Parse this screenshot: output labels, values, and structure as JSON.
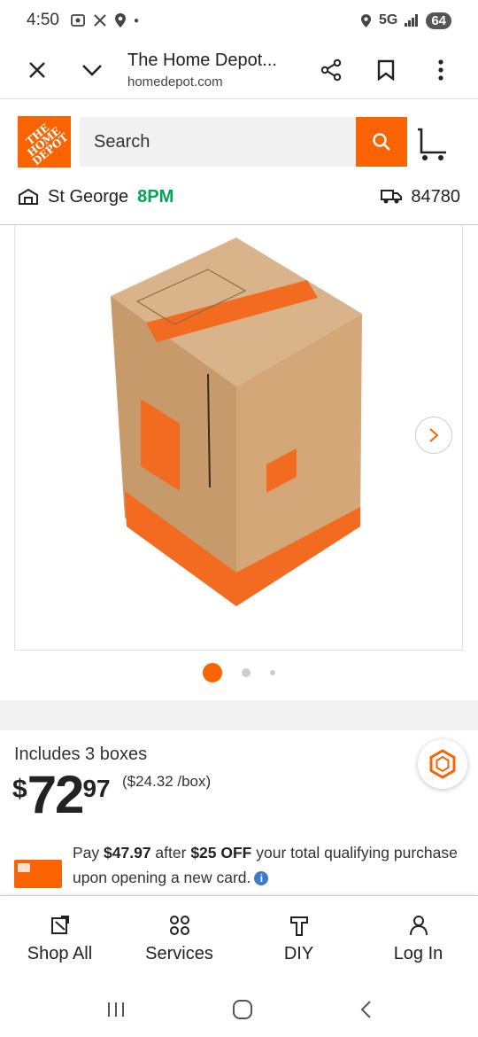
{
  "status_bar": {
    "time": "4:50",
    "network": "5G",
    "battery": "64"
  },
  "browser": {
    "title": "The Home Depot...",
    "url": "homedepot.com"
  },
  "header": {
    "logo_text": "THE HOME DEPOT",
    "search_placeholder": "Search",
    "store_name": "St George",
    "store_time": "8PM",
    "zip": "84780"
  },
  "gallery": {
    "total_images": 3,
    "current_index": 1
  },
  "product": {
    "includes": "Includes 3 boxes",
    "price_symbol": "$",
    "price_whole": "72",
    "price_cents": "97",
    "unit_price": "($24.32 /box)"
  },
  "promo": {
    "pay_prefix": "Pay ",
    "pay_amount": "$47.97",
    "after_text": " after ",
    "off_amount": "$25 OFF",
    "rest": " your total qualifying purchase upon opening a new card."
  },
  "bottom_nav": {
    "items": [
      {
        "label": "Shop All",
        "icon": "shop-all-icon"
      },
      {
        "label": "Services",
        "icon": "services-icon"
      },
      {
        "label": "DIY",
        "icon": "diy-icon"
      },
      {
        "label": "Log In",
        "icon": "user-icon"
      }
    ]
  },
  "colors": {
    "brand_orange": "#f96302",
    "store_time_green": "#00a650",
    "info_blue": "#3e7cc9"
  }
}
